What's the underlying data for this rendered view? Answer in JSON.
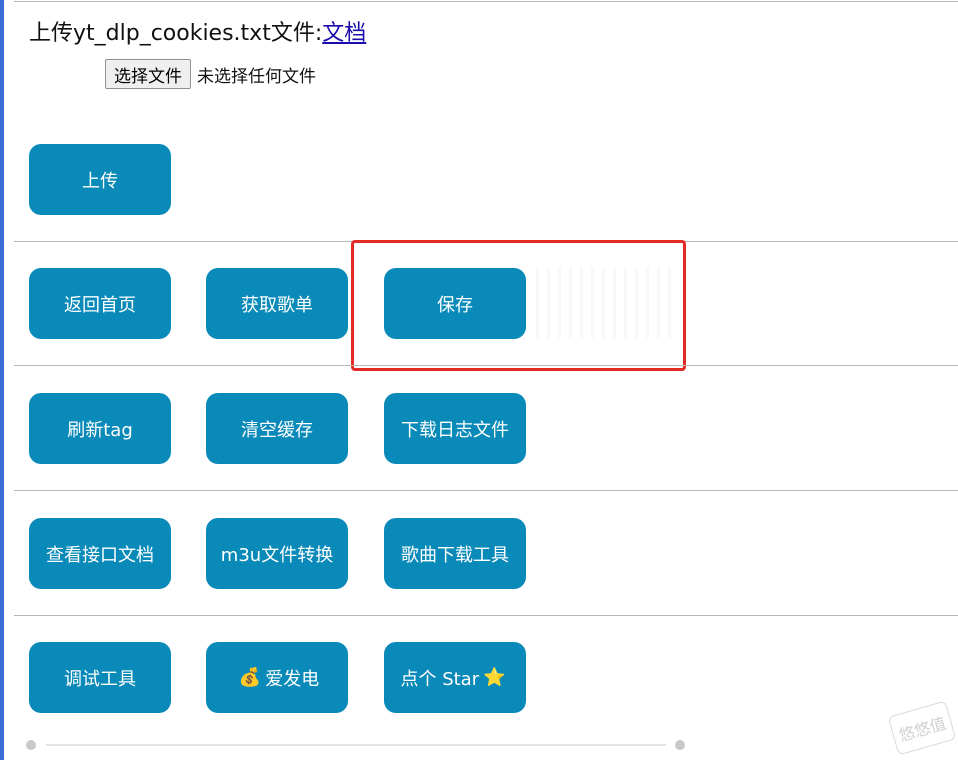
{
  "upload": {
    "title_prefix": "上传yt_dlp_cookies.txt文件:",
    "doc_link": "文档",
    "choose_file_label": "选择文件",
    "no_file_text": "未选择任何文件"
  },
  "buttons": {
    "upload": "上传",
    "back_home": "返回首页",
    "get_playlist": "获取歌单",
    "save": "保存",
    "refresh_tag": "刷新tag",
    "clear_cache": "清空缓存",
    "download_log": "下载日志文件",
    "view_api_docs": "查看接口文档",
    "m3u_convert": "m3u文件转换",
    "song_download_tool": "歌曲下载工具",
    "debug_tool": "调试工具",
    "sponsor_emoji": "💰",
    "sponsor": "爱发电",
    "star_text": "点个 Star",
    "star_emoji": "⭐"
  },
  "watermark": "悠悠值",
  "colors": {
    "button_bg": "#0a8ab8",
    "highlight_border": "#e32b25",
    "link": "#1a0dab"
  }
}
